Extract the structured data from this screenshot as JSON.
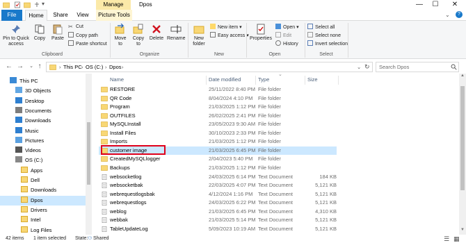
{
  "window": {
    "title": "Dpos",
    "contextual_tab": "Manage",
    "controls": [
      "minimize",
      "maximize",
      "close"
    ]
  },
  "tabs": [
    {
      "label": "File"
    },
    {
      "label": "Home"
    },
    {
      "label": "Share"
    },
    {
      "label": "View"
    },
    {
      "label": "Picture Tools"
    }
  ],
  "ribbon": {
    "clipboard": {
      "pin_label": "Pin to Quick access",
      "copy_label": "Copy",
      "paste_label": "Paste",
      "cut_label": "Cut",
      "copy_path_label": "Copy path",
      "paste_shortcut_label": "Paste shortcut",
      "group_label": "Clipboard"
    },
    "organize": {
      "move_label": "Move to",
      "copy_to_label": "Copy to",
      "delete_label": "Delete",
      "rename_label": "Rename",
      "group_label": "Organize"
    },
    "new": {
      "new_folder_label": "New folder",
      "new_item_label": "New item",
      "easy_access_label": "Easy access",
      "group_label": "New"
    },
    "open": {
      "properties_label": "Properties",
      "open_label": "Open",
      "edit_label": "Edit",
      "history_label": "History",
      "group_label": "Open"
    },
    "select": {
      "select_all_label": "Select all",
      "select_none_label": "Select none",
      "invert_label": "Invert selection",
      "group_label": "Select"
    }
  },
  "address": {
    "crumbs": [
      "This PC",
      "OS (C:)",
      "Dpos"
    ],
    "search_placeholder": "Search Dpos"
  },
  "nav": [
    {
      "label": "This PC",
      "icon": "computer-icon"
    },
    {
      "label": "3D Objects",
      "icon": "cube-icon"
    },
    {
      "label": "Desktop",
      "icon": "desktop-icon"
    },
    {
      "label": "Documents",
      "icon": "document-icon"
    },
    {
      "label": "Downloads",
      "icon": "download-icon"
    },
    {
      "label": "Music",
      "icon": "music-icon"
    },
    {
      "label": "Pictures",
      "icon": "pictures-icon"
    },
    {
      "label": "Videos",
      "icon": "video-icon"
    },
    {
      "label": "OS (C:)",
      "icon": "drive-icon"
    },
    {
      "label": "Apps",
      "icon": "folder-icon"
    },
    {
      "label": "Dell",
      "icon": "folder-icon"
    },
    {
      "label": "Downloads",
      "icon": "folder-icon"
    },
    {
      "label": "Dpos",
      "icon": "folder-icon",
      "selected": true
    },
    {
      "label": "Drivers",
      "icon": "folder-icon"
    },
    {
      "label": "Intel",
      "icon": "folder-icon"
    },
    {
      "label": "Log Files",
      "icon": "folder-icon"
    }
  ],
  "columns": {
    "name": "Name",
    "date": "Date modified",
    "type": "Type",
    "size": "Size"
  },
  "files": [
    {
      "name": "RESTORE",
      "date": "25/11/2022 8:40 PM",
      "type": "File folder",
      "size": "",
      "kind": "folder"
    },
    {
      "name": "QR Code",
      "date": "8/04/2024 4:10 PM",
      "type": "File folder",
      "size": "",
      "kind": "folder"
    },
    {
      "name": "Program",
      "date": "21/03/2025 1:12 PM",
      "type": "File folder",
      "size": "",
      "kind": "folder"
    },
    {
      "name": "OUTFILES",
      "date": "26/02/2025 2:41 PM",
      "type": "File folder",
      "size": "",
      "kind": "folder"
    },
    {
      "name": "MySQLInstall",
      "date": "23/05/2023 9:30 AM",
      "type": "File folder",
      "size": "",
      "kind": "folder"
    },
    {
      "name": "Install Files",
      "date": "30/10/2023 2:33 PM",
      "type": "File folder",
      "size": "",
      "kind": "folder"
    },
    {
      "name": "Imports",
      "date": "21/03/2025 1:12 PM",
      "type": "File folder",
      "size": "",
      "kind": "folder"
    },
    {
      "name": "customer image",
      "date": "21/03/2025 6:45 PM",
      "type": "File folder",
      "size": "",
      "kind": "folder",
      "selected": true
    },
    {
      "name": "CreatedMySQLlogger",
      "date": "2/04/2023 5:40 PM",
      "type": "File folder",
      "size": "",
      "kind": "folder"
    },
    {
      "name": "Backups",
      "date": "21/03/2025 1:12 PM",
      "type": "File folder",
      "size": "",
      "kind": "folder"
    },
    {
      "name": "websocketlog",
      "date": "24/03/2025 6:14 PM",
      "type": "Text Document",
      "size": "184 KB",
      "kind": "text"
    },
    {
      "name": "websocketbak",
      "date": "22/03/2025 4:07 PM",
      "type": "Text Document",
      "size": "5,121 KB",
      "kind": "text"
    },
    {
      "name": "webrequestlogsbak",
      "date": "4/12/2024 1:16 PM",
      "type": "Text Document",
      "size": "5,121 KB",
      "kind": "text"
    },
    {
      "name": "webrequestlogs",
      "date": "24/03/2025 6:22 PM",
      "type": "Text Document",
      "size": "5,121 KB",
      "kind": "text"
    },
    {
      "name": "weblog",
      "date": "21/03/2025 6:45 PM",
      "type": "Text Document",
      "size": "4,310 KB",
      "kind": "text"
    },
    {
      "name": "webbak",
      "date": "21/03/2025 5:14 PM",
      "type": "Text Document",
      "size": "5,121 KB",
      "kind": "text"
    },
    {
      "name": "TableUpdateLog",
      "date": "5/09/2023 10:19 AM",
      "type": "Text Document",
      "size": "5,121 KB",
      "kind": "text"
    }
  ],
  "status": {
    "items_count": "42 items",
    "selected_count": "1 item selected",
    "state_label": "State:",
    "state_value": "Shared"
  },
  "colors": {
    "file_tab": "#1979ca",
    "selection": "#cce8ff",
    "folder": "#f8d775",
    "annotation": "#e0001a"
  }
}
